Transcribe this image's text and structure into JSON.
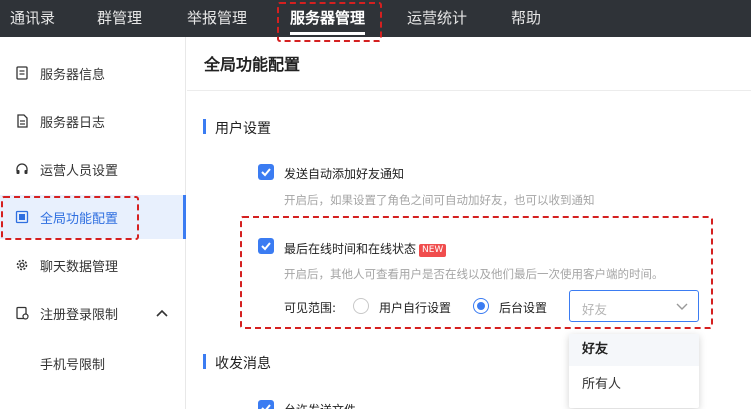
{
  "topnav": {
    "tabs": [
      {
        "label": "通讯录"
      },
      {
        "label": "群管理"
      },
      {
        "label": "举报管理"
      },
      {
        "label": "服务器管理"
      },
      {
        "label": "运营统计"
      },
      {
        "label": "帮助"
      }
    ],
    "active_index": 3
  },
  "sidebar": {
    "items": [
      {
        "label": "服务器信息",
        "icon": "server-info-icon"
      },
      {
        "label": "服务器日志",
        "icon": "log-icon"
      },
      {
        "label": "运营人员设置",
        "icon": "headset-icon"
      },
      {
        "label": "全局功能配置",
        "icon": "global-config-icon"
      },
      {
        "label": "聊天数据管理",
        "icon": "gear-icon"
      },
      {
        "label": "注册登录限制",
        "icon": "register-icon"
      }
    ],
    "sub_items": [
      {
        "label": "手机号限制"
      }
    ],
    "active_index": 3
  },
  "main": {
    "title": "全局功能配置",
    "sections": [
      {
        "title": "用户设置",
        "options": [
          {
            "label": "发送自动添加好友通知",
            "desc": "开启后，如果设置了角色之间可自动加好友，也可以收到通知",
            "checked": true
          },
          {
            "label": "最后在线时间和在线状态",
            "badge": "NEW",
            "desc": "开启后，其他人可查看用户是否在线以及他们最后一次使用客户端的时间。",
            "checked": true,
            "visibility": {
              "label": "可见范围:",
              "options": [
                {
                  "label": "用户自行设置",
                  "selected": false
                },
                {
                  "label": "后台设置",
                  "selected": true
                }
              ],
              "select_placeholder": "好友",
              "dropdown": [
                {
                  "label": "好友",
                  "selected": true
                },
                {
                  "label": "所有人",
                  "selected": false
                }
              ]
            }
          }
        ]
      },
      {
        "title": "收发消息",
        "options": [
          {
            "label": "允许发送文件",
            "checked": true
          }
        ]
      }
    ]
  },
  "colors": {
    "accent": "#3b7cf2",
    "topnav_bg": "#2f3338",
    "highlight_red": "#d52020",
    "badge_red": "#f04d4d"
  }
}
